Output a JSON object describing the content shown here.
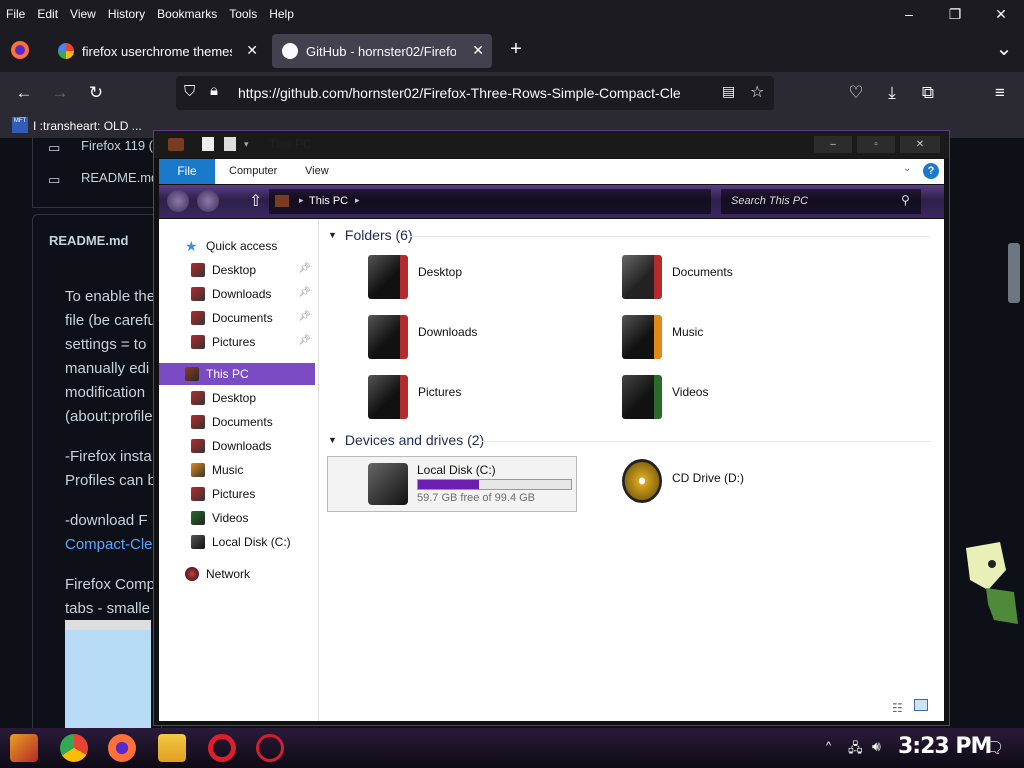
{
  "firefox": {
    "menu": [
      "File",
      "Edit",
      "View",
      "History",
      "Bookmarks",
      "Tools",
      "Help"
    ],
    "window_controls": {
      "minimize": "–",
      "maximize": "❐",
      "close": "✕"
    },
    "tabs": [
      {
        "title": "firefox userchrome themes - ",
        "icon": "google-icon"
      },
      {
        "title": "GitHub - hornster02/Firefox-",
        "icon": "github-icon"
      }
    ],
    "new_tab": "+",
    "tab_list": "⌄",
    "url": "https://github.com/hornster02/Firefox-Three-Rows-Simple-Compact-Cle",
    "bookmarks": [
      {
        "label": "I :transheart: OLD ...",
        "icon": "mft-icon"
      }
    ],
    "nav_icons": [
      "back-icon",
      "forward-icon",
      "reload-icon",
      "pocket-icon",
      "download-icon",
      "extensions-icon",
      "menu-icon"
    ]
  },
  "page": {
    "file_rows": [
      "Firefox 119 (",
      "README.md"
    ],
    "readme_title": "README.md",
    "lines": [
      "To enable the",
      "file (be carefu",
      "settings = to",
      "manually edi",
      "modification",
      "(about:profile",
      "-Firefox insta",
      "Profiles can b",
      "-download F",
      "Compact-Cle",
      "Firefox Comp",
      "tabs - smalle"
    ]
  },
  "explorer": {
    "title": "This PC",
    "ribbon_tabs": [
      "File",
      "Computer",
      "View"
    ],
    "breadcrumb": "This PC",
    "search_placeholder": "Search This PC",
    "quick_access": {
      "label": "Quick access",
      "items": [
        "Desktop",
        "Downloads",
        "Documents",
        "Pictures"
      ]
    },
    "this_pc": {
      "label": "This PC",
      "items": [
        "Desktop",
        "Documents",
        "Downloads",
        "Music",
        "Pictures",
        "Videos",
        "Local Disk (C:)"
      ]
    },
    "network": "Network",
    "folders_header": "Folders (6)",
    "folders": [
      "Desktop",
      "Documents",
      "Downloads",
      "Music",
      "Pictures",
      "Videos"
    ],
    "devices_header": "Devices and drives (2)",
    "drives": [
      {
        "name": "Local Disk (C:)",
        "free": "59.7 GB free of 99.4 GB",
        "used_fraction": 0.4
      },
      {
        "name": "CD Drive (D:)"
      }
    ]
  },
  "taskbar": {
    "clock": "3:23 PM",
    "apps": [
      "start-icon",
      "chrome-icon",
      "firefox-icon",
      "file-explorer-icon",
      "opera-icon",
      "opera-gx-icon"
    ]
  },
  "colors": {
    "accent": "#7b4bc4",
    "firefox_bg": "#1c1b22",
    "selection": "#7b4bc4",
    "drive_bar": "#6a1fb0"
  }
}
